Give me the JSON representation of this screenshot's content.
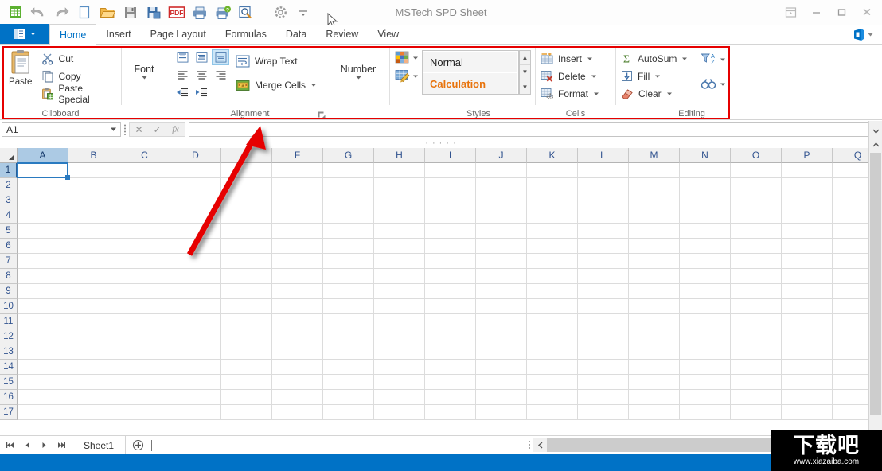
{
  "window": {
    "title": "MSTech SPD Sheet",
    "controls": [
      {
        "name": "ribbon-display-options",
        "glyph": "▣"
      },
      {
        "name": "minimize",
        "glyph": "—"
      },
      {
        "name": "restore",
        "glyph": "❐"
      },
      {
        "name": "close",
        "glyph": "✕"
      }
    ]
  },
  "quick_access": [
    {
      "name": "app-logo-icon",
      "label": "MSTech SPD Sheet"
    },
    {
      "name": "undo-icon",
      "label": "Undo"
    },
    {
      "name": "redo-icon",
      "label": "Redo"
    },
    {
      "name": "new-icon",
      "label": "New"
    },
    {
      "name": "open-icon",
      "label": "Open"
    },
    {
      "name": "save-icon",
      "label": "Save"
    },
    {
      "name": "save-as-icon",
      "label": "Save As"
    },
    {
      "name": "export-pdf-icon",
      "label": "Export PDF"
    },
    {
      "name": "print-icon",
      "label": "Print"
    },
    {
      "name": "quick-print-icon",
      "label": "Quick Print"
    },
    {
      "name": "print-preview-icon",
      "label": "Print Preview"
    },
    {
      "name": "options-icon",
      "label": "Options"
    },
    {
      "name": "customize-qat-icon",
      "label": "Customize Quick Access Toolbar"
    }
  ],
  "tabs": {
    "file_menu_label": "",
    "items": [
      {
        "label": "Home",
        "active": true
      },
      {
        "label": "Insert",
        "active": false
      },
      {
        "label": "Page Layout",
        "active": false
      },
      {
        "label": "Formulas",
        "active": false
      },
      {
        "label": "Data",
        "active": false
      },
      {
        "label": "Review",
        "active": false
      },
      {
        "label": "View",
        "active": false
      }
    ]
  },
  "ribbon": {
    "clipboard": {
      "label": "Clipboard",
      "paste": "Paste",
      "items": [
        {
          "label": "Cut",
          "icon": "scissors-icon"
        },
        {
          "label": "Copy",
          "icon": "copy-icon"
        },
        {
          "label": "Paste Special",
          "icon": "paste-special-icon"
        }
      ]
    },
    "font": {
      "label": "Font"
    },
    "alignment": {
      "label": "Alignment",
      "buttons": [
        {
          "name": "align-top",
          "selected": false
        },
        {
          "name": "align-middle",
          "selected": false
        },
        {
          "name": "align-bottom",
          "selected": true
        },
        {
          "name": "align-left",
          "selected": false
        },
        {
          "name": "align-center",
          "selected": false
        },
        {
          "name": "align-right",
          "selected": false
        },
        {
          "name": "decrease-indent",
          "selected": false
        },
        {
          "name": "increase-indent",
          "selected": false
        }
      ],
      "wrap_text": "Wrap Text",
      "merge_cells": "Merge Cells"
    },
    "number": {
      "label": "Number"
    },
    "styles": {
      "label": "Styles",
      "gallery": [
        {
          "label": "Normal",
          "color": "#222222"
        },
        {
          "label": "Calculation",
          "color": "#e8730c"
        }
      ]
    },
    "cells": {
      "label": "Cells",
      "items": [
        {
          "label": "Insert",
          "icon": "insert-cells-icon"
        },
        {
          "label": "Delete",
          "icon": "delete-cells-icon"
        },
        {
          "label": "Format",
          "icon": "format-cells-icon"
        }
      ]
    },
    "editing": {
      "label": "Editing",
      "items": [
        {
          "label": "AutoSum",
          "icon": "sigma-icon"
        },
        {
          "label": "Fill",
          "icon": "fill-down-icon"
        },
        {
          "label": "Clear",
          "icon": "eraser-icon"
        }
      ],
      "right_items": [
        {
          "name": "sort-filter-icon",
          "label": "Sort & Filter"
        },
        {
          "name": "find-select-icon",
          "label": "Find & Select"
        }
      ]
    }
  },
  "formula_bar": {
    "name_box": "A1",
    "formula": "",
    "cancel_glyph": "✕",
    "enter_glyph": "✓",
    "fx_glyph": "fx"
  },
  "grid": {
    "columns": [
      "A",
      "B",
      "C",
      "D",
      "E",
      "F",
      "G",
      "H",
      "I",
      "J",
      "K",
      "L",
      "M",
      "N",
      "O",
      "P",
      "Q"
    ],
    "rows": [
      1,
      2,
      3,
      4,
      5,
      6,
      7,
      8,
      9,
      10,
      11,
      12,
      13,
      14,
      15,
      16,
      17
    ],
    "selected_cell": "A1",
    "selected_column": "A",
    "selected_row": 1
  },
  "sheet_bar": {
    "nav": [
      "⏮",
      "◀",
      "▶",
      "⏭"
    ],
    "tabs": [
      {
        "label": "Sheet1",
        "active": true
      }
    ],
    "add_sheet_glyph": "⊕"
  },
  "watermark": {
    "text": "下载吧",
    "url": "www.xiazaiba.com"
  },
  "colors": {
    "accent": "#0072c6",
    "annotation": "#e60000",
    "selection": "#accae4",
    "calculation": "#e8730c"
  }
}
